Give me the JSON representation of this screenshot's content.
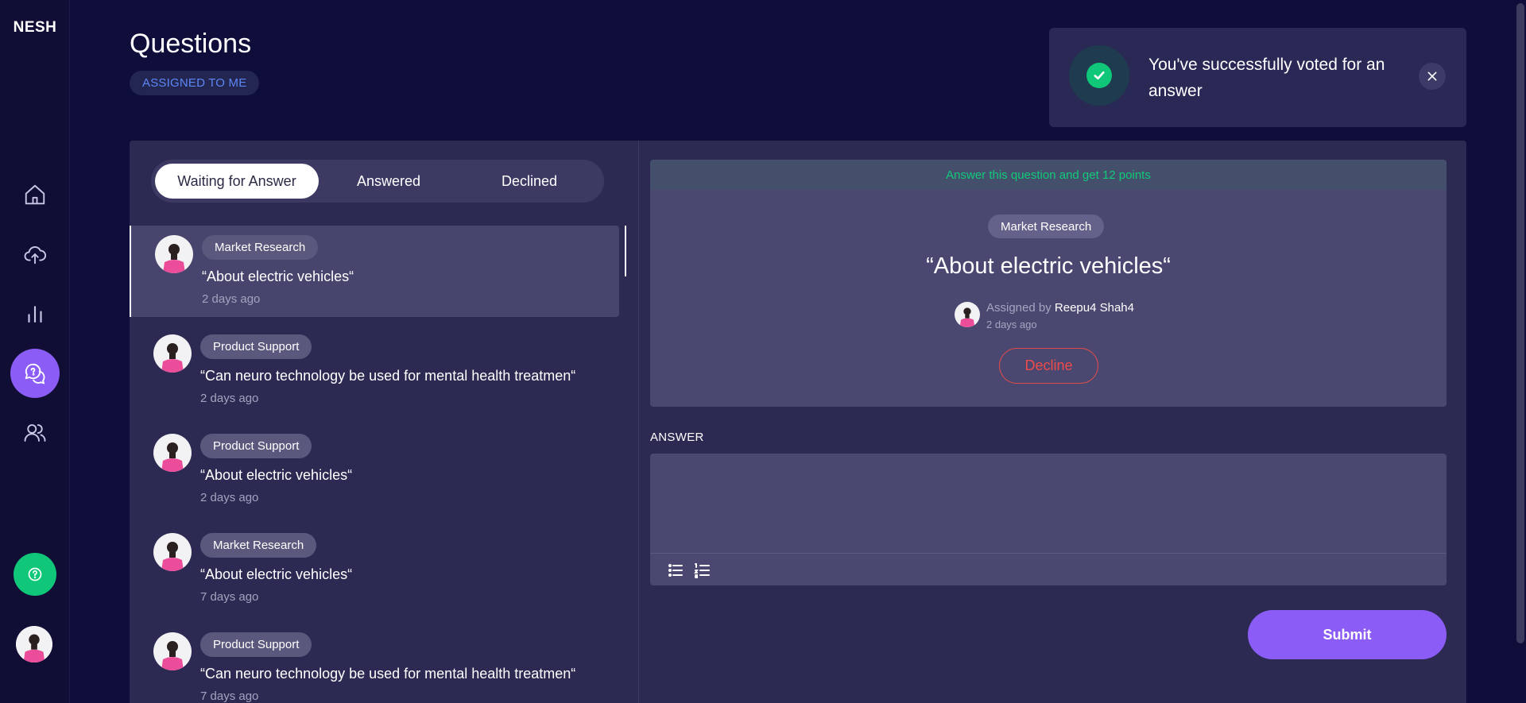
{
  "app": {
    "logo": "NESH"
  },
  "sidebar": {
    "items": [
      {
        "icon": "home-icon"
      },
      {
        "icon": "upload-cloud-icon"
      },
      {
        "icon": "bar-chart-icon"
      },
      {
        "icon": "questions-icon",
        "active": true
      },
      {
        "icon": "users-icon"
      }
    ],
    "help_icon": "help-icon"
  },
  "header": {
    "title": "Questions",
    "filter": "ASSIGNED TO ME"
  },
  "toast": {
    "message": "You've successfully voted for an answer"
  },
  "tabs": {
    "waiting": "Waiting for Answer",
    "answered": "Answered",
    "declined": "Declined",
    "active": "waiting"
  },
  "questions": [
    {
      "tag": "Market Research",
      "text": "“About electric vehicles“",
      "time": "2 days ago",
      "selected": true
    },
    {
      "tag": "Product Support",
      "text": "“Can neuro technology be used for mental health treatmen“",
      "time": "2 days ago"
    },
    {
      "tag": "Product Support",
      "text": "“About electric vehicles“",
      "time": "2 days ago"
    },
    {
      "tag": "Market Research",
      "text": "“About electric vehicles“",
      "time": "7 days ago"
    },
    {
      "tag": "Product Support",
      "text": "“Can neuro technology be used for mental health treatmen“",
      "time": "7 days ago"
    }
  ],
  "detail": {
    "points_banner": "Answer this question and get 12 points",
    "tag": "Market Research",
    "title": "“About electric vehicles“",
    "assigned_prefix": "Assigned by",
    "assigned_by": "Reepu4 Shah4",
    "time": "2 days ago",
    "decline_label": "Decline"
  },
  "answer": {
    "label": "ANSWER",
    "value": "",
    "bullet_list_icon": "bullet-list-icon",
    "numbered_list_icon": "numbered-list-icon",
    "submit_label": "Submit"
  },
  "colors": {
    "background": "#0f0d3a",
    "accent": "#8b5cf6",
    "success": "#10c779",
    "danger": "#ef4b4b"
  }
}
